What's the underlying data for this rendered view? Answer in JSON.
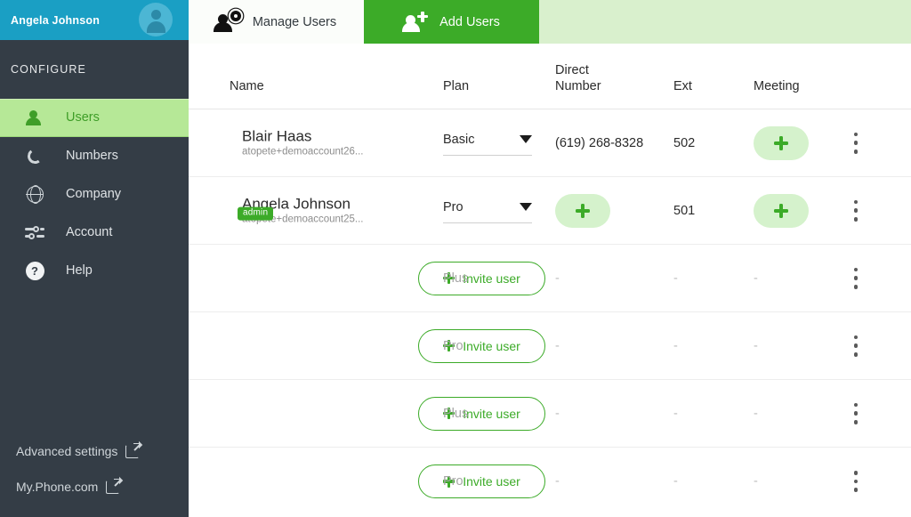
{
  "sidebar": {
    "account_name": "Angela Johnson",
    "avatar_icon": "user-avatar-icon",
    "section_label": "CONFIGURE",
    "items": [
      {
        "label": "Users",
        "icon": "user-icon",
        "active": true
      },
      {
        "label": "Numbers",
        "icon": "phone-icon",
        "active": false
      },
      {
        "label": "Company",
        "icon": "globe-icon",
        "active": false
      },
      {
        "label": "Account",
        "icon": "sliders-icon",
        "active": false
      },
      {
        "label": "Help",
        "icon": "question-circle-icon",
        "active": false
      }
    ],
    "bottom_links": [
      {
        "label": "Advanced settings",
        "icon": "external-link-icon"
      },
      {
        "label": "My.Phone.com",
        "icon": "external-link-icon"
      }
    ]
  },
  "tabs": [
    {
      "label": "Manage Users",
      "icon": "user-gear-icon",
      "active": false
    },
    {
      "label": "Add Users",
      "icon": "user-plus-icon",
      "active": true
    }
  ],
  "table": {
    "columns": [
      {
        "key": "name",
        "label": "Name"
      },
      {
        "key": "plan",
        "label": "Plan"
      },
      {
        "key": "direct",
        "label": "Direct\nNumber",
        "line1": "Direct",
        "line2": "Number"
      },
      {
        "key": "ext",
        "label": "Ext"
      },
      {
        "key": "meet",
        "label": "Meeting"
      }
    ],
    "rows": [
      {
        "type": "user",
        "name": "Blair Haas",
        "email": "atopete+demoaccount26...",
        "badge": "",
        "plan": "Basic",
        "plan_control": "select",
        "direct": "(619) 268-8328",
        "direct_control": "text",
        "ext": "502",
        "meeting_control": "add-button",
        "meeting": ""
      },
      {
        "type": "user",
        "name": "Angela Johnson",
        "email": "atopete+demoaccount25...",
        "badge": "admin",
        "plan": "Pro",
        "plan_control": "select",
        "direct": "",
        "direct_control": "add-button",
        "ext": "501",
        "meeting_control": "add-button",
        "meeting": ""
      },
      {
        "type": "invite",
        "invite_label": "Invite user",
        "plan": "Plus",
        "plan_control": "text",
        "direct": "-",
        "direct_control": "text",
        "ext": "-",
        "meeting": "-",
        "meeting_control": "text"
      },
      {
        "type": "invite",
        "invite_label": "Invite user",
        "plan": "Pro",
        "plan_control": "text",
        "direct": "-",
        "direct_control": "text",
        "ext": "-",
        "meeting": "-",
        "meeting_control": "text"
      },
      {
        "type": "invite",
        "invite_label": "Invite user",
        "plan": "Plus",
        "plan_control": "text",
        "direct": "-",
        "direct_control": "text",
        "ext": "-",
        "meeting": "-",
        "meeting_control": "text"
      },
      {
        "type": "invite",
        "invite_label": "Invite user",
        "plan": "Pro",
        "plan_control": "text",
        "direct": "-",
        "direct_control": "text",
        "ext": "-",
        "meeting": "-",
        "meeting_control": "text"
      }
    ],
    "row_menu_icon": "kebab-menu-icon"
  },
  "colors": {
    "sidebar_bg": "#343d46",
    "sidebar_header_bg": "#1a9fc4",
    "active_nav_bg": "#b6e897",
    "active_nav_text": "#3f9e28",
    "accent_green": "#3cab28",
    "tab_strip_bg": "#d9f0cd",
    "pill_bg": "#d5f2cc",
    "badge_bg": "#3cab28"
  }
}
